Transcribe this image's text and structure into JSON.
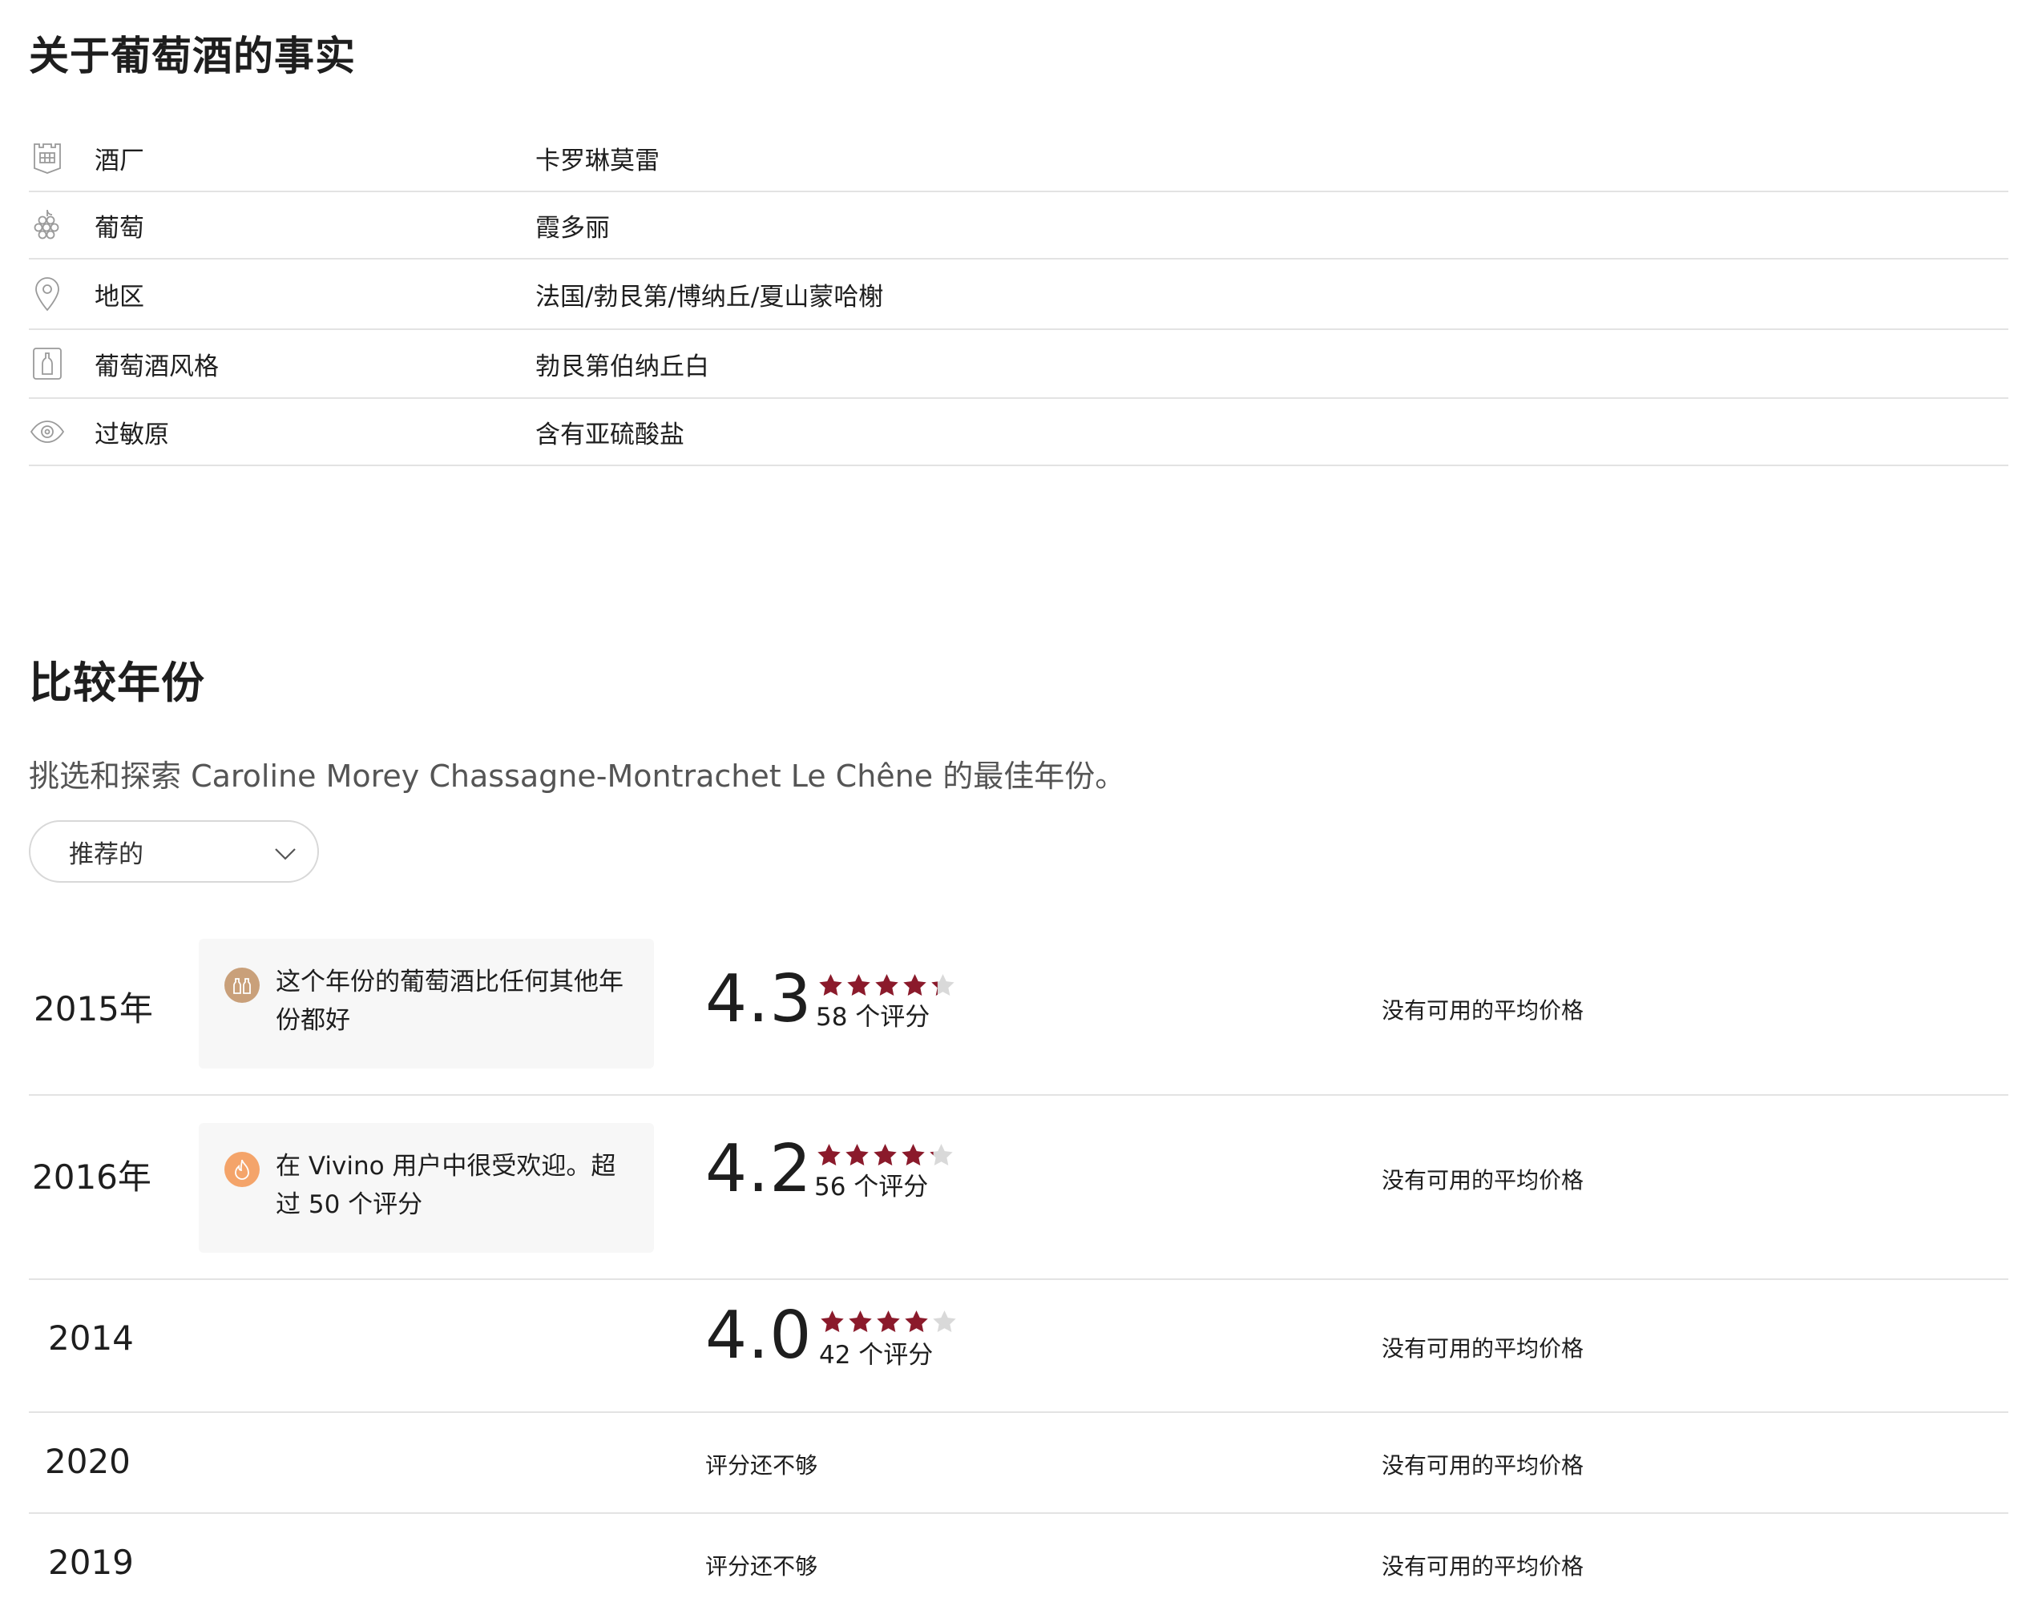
{
  "facts_section": {
    "title": "关于葡萄酒的事实",
    "rows": [
      {
        "icon": "winery-castle-icon",
        "label": "酒厂",
        "value": "卡罗琳莫雷"
      },
      {
        "icon": "grape-icon",
        "label": "葡萄",
        "value": "霞多丽"
      },
      {
        "icon": "location-pin-icon",
        "label": "地区",
        "value": "法国/勃艮第/博纳丘/夏山蒙哈榭"
      },
      {
        "icon": "wine-bottle-icon",
        "label": "葡萄酒风格",
        "value": "勃艮第伯纳丘白"
      },
      {
        "icon": "eye-icon",
        "label": "过敏原",
        "value": "含有亚硫酸盐"
      }
    ]
  },
  "vintages_section": {
    "title": "比较年份",
    "subtitle": "挑选和探索 Caroline Morey Chassagne-Montrachet Le Chêne 的最佳年份。",
    "sort": {
      "label": "推荐的"
    },
    "rows": [
      {
        "year": "2015年",
        "highlight": "这个年份的葡萄酒比任何其他年份都好",
        "highlight_icon": "bottles-badge-icon",
        "score": "4.3",
        "rating": 4.3,
        "count": "58 个评分",
        "price": "没有可用的平均价格"
      },
      {
        "year": "2016年",
        "highlight": "在 Vivino 用户中很受欢迎。超过 50 个评分",
        "highlight_icon": "flame-badge-icon",
        "score": "4.2",
        "rating": 4.2,
        "count": "56 个评分",
        "price": "没有可用的平均价格"
      },
      {
        "year": "2014",
        "highlight": "",
        "score": "4.0",
        "rating": 4.0,
        "count": "42 个评分",
        "price": "没有可用的平均价格"
      },
      {
        "year": "2020",
        "not_enough": "评分还不够",
        "price": "没有可用的平均价格"
      },
      {
        "year": "2019",
        "not_enough": "评分还不够",
        "price": "没有可用的平均价格"
      }
    ]
  },
  "colors": {
    "star_filled": "#8b1a2b",
    "star_empty": "#d9d9d9",
    "badge_bronze": "#c9a07a",
    "badge_orange": "#f4a46a"
  }
}
